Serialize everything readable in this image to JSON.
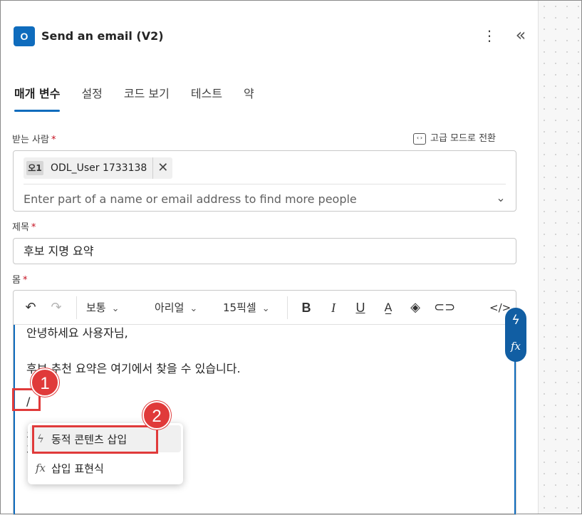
{
  "header": {
    "title": "Send an email (V2)",
    "app_icon": "outlook-icon",
    "menu_icon": "more-vertical-icon",
    "collapse_icon": "collapse-double-chevron-icon"
  },
  "tabs": [
    {
      "label": "매개 변수",
      "active": true
    },
    {
      "label": "설정",
      "active": false
    },
    {
      "label": "코드 보기",
      "active": false
    },
    {
      "label": "테스트",
      "active": false
    },
    {
      "label": "약",
      "active": false
    }
  ],
  "to_field": {
    "label": "받는 사람",
    "required_mark": "*",
    "advanced_switch": "고급 모드로 전환",
    "chip_avatar": "오1",
    "chip_name": "ODL_User 1733138",
    "chip_remove": "✕",
    "placeholder": "Enter part of a name or email address to find more people"
  },
  "subject_field": {
    "label": "제목",
    "required_mark": "*",
    "value": "후보 지명 요약"
  },
  "body_field": {
    "label": "몸",
    "required_mark": "*",
    "toolbar": {
      "undo": "↶",
      "redo": "↷",
      "paragraph_style": "보통",
      "font": "아리얼",
      "font_size": "15픽셀",
      "bold": "B",
      "italic": "I",
      "underline": "U",
      "code": "</>"
    },
    "lines": [
      "안녕하세요 사용자님,",
      "후보 추천 요약은 여기에서 찾을 수 있습니다.",
      "/"
    ],
    "hidden_line_start_1": "긷",
    "hidden_line_start_2": "가"
  },
  "side_tools": {
    "dynamic_icon": "lightning-icon",
    "expression_icon": "fx-icon"
  },
  "insert_menu": {
    "items": [
      {
        "label": "동적 콘텐츠 삽입",
        "icon": "lightning-icon"
      },
      {
        "label": "삽입 표현식",
        "icon": "fx-icon"
      }
    ]
  },
  "annotations": {
    "step1": "1",
    "step2": "2",
    "color": "#e03a3a"
  },
  "colors": {
    "accent": "#0f6cbd",
    "required": "#c50f1f"
  }
}
